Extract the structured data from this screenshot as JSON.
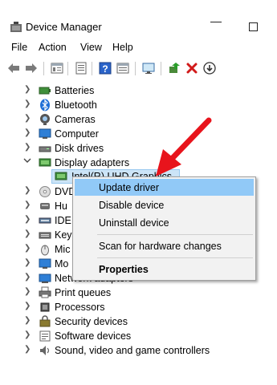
{
  "window": {
    "title": "Device Manager",
    "minimize_glyph": "—",
    "maximize_glyph": "☐"
  },
  "menu": [
    "File",
    "Action",
    "View",
    "Help"
  ],
  "toolbar": {
    "icons": [
      "back-arrow-icon",
      "forward-arrow-icon",
      "properties-grid-icon",
      "list-view-icon",
      "help-icon",
      "details-view-icon",
      "scan-monitor-icon",
      "update-driver-icon",
      "uninstall-x-icon",
      "download-circle-icon"
    ]
  },
  "tree": {
    "items": [
      {
        "label": "Batteries",
        "icon": "battery-icon"
      },
      {
        "label": "Bluetooth",
        "icon": "bluetooth-icon"
      },
      {
        "label": "Cameras",
        "icon": "camera-icon"
      },
      {
        "label": "Computer",
        "icon": "computer-icon"
      },
      {
        "label": "Disk drives",
        "icon": "disk-drive-icon"
      },
      {
        "label": "Display adapters",
        "icon": "display-adapter-icon",
        "expanded": true
      },
      {
        "label": "Intel(R) UHD Graphics",
        "icon": "display-adapter-icon",
        "child": true
      },
      {
        "label": "DVD/CD-ROM drives",
        "icon": "dvd-icon"
      },
      {
        "label": "Human Interface Devices",
        "icon": "hid-icon"
      },
      {
        "label": "IDE ATA/ATAPI controllers",
        "icon": "ide-icon"
      },
      {
        "label": "Keyboards",
        "icon": "keyboard-icon"
      },
      {
        "label": "Mice and other pointing devices",
        "icon": "mouse-icon"
      },
      {
        "label": "Monitors",
        "icon": "monitor-icon"
      },
      {
        "label": "Network adapters",
        "icon": "network-icon"
      },
      {
        "label": "Print queues",
        "icon": "printer-icon"
      },
      {
        "label": "Processors",
        "icon": "processor-icon"
      },
      {
        "label": "Security devices",
        "icon": "security-icon"
      },
      {
        "label": "Software devices",
        "icon": "software-icon"
      },
      {
        "label": "Sound, video and game controllers",
        "icon": "sound-icon"
      }
    ],
    "visible_labels": {
      "batteries": "Batteries",
      "bluetooth": "Bluetooth",
      "cameras": "Cameras",
      "computer": "Computer",
      "disk_drives": "Disk drives",
      "display_adapters": "Display adapters",
      "intel_graphics": "Intel(R) UHD Graphics",
      "dvd": "DVD",
      "hid": "Hu",
      "ide": "IDE",
      "keyboards": "Key",
      "mice": "Mic",
      "monitors": "Mo",
      "network": "Network adapters",
      "print_queues": "Print queues",
      "processors": "Processors",
      "security": "Security devices",
      "software": "Software devices",
      "sound": "Sound, video and game controllers"
    }
  },
  "context_menu": {
    "update_driver": "Update driver",
    "disable_device": "Disable device",
    "uninstall_device": "Uninstall device",
    "scan_hardware": "Scan for hardware changes",
    "properties": "Properties"
  },
  "colors": {
    "selection": "#cce4f7",
    "menu_hover": "#91c9f7",
    "annotation_arrow": "#e8141c"
  }
}
